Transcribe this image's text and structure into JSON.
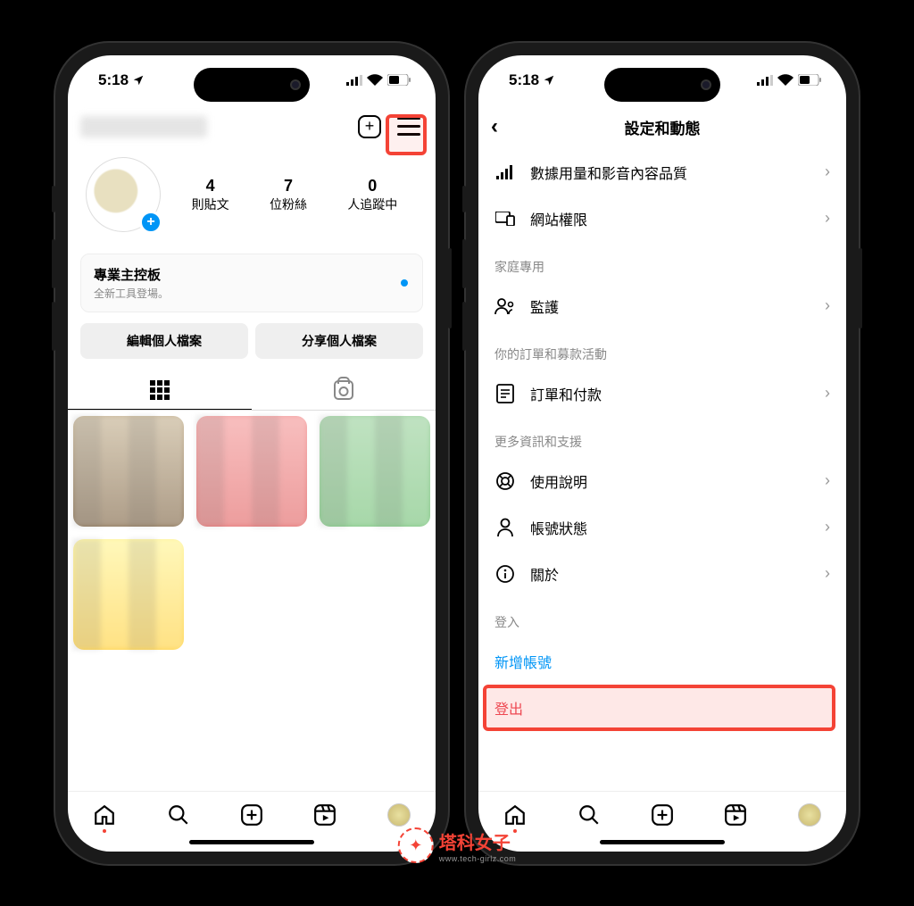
{
  "status": {
    "time": "5:18",
    "location_arrow": "➤"
  },
  "profile": {
    "stats": {
      "posts_num": "4",
      "posts_lbl": "則貼文",
      "followers_num": "7",
      "followers_lbl": "位粉絲",
      "following_num": "0",
      "following_lbl": "人追蹤中"
    },
    "dashboard": {
      "title": "專業主控板",
      "sub": "全新工具登場。"
    },
    "edit_btn": "編輯個人檔案",
    "share_btn": "分享個人檔案"
  },
  "settings": {
    "title": "設定和動態",
    "rows": {
      "data_quality": "數據用量和影音內容品質",
      "website": "網站權限"
    },
    "section_family": "家庭專用",
    "supervision": "監護",
    "section_orders": "你的訂單和募款活動",
    "orders": "訂單和付款",
    "section_more": "更多資訊和支援",
    "help": "使用說明",
    "account_status": "帳號狀態",
    "about": "關於",
    "section_login": "登入",
    "add_account": "新增帳號",
    "logout": "登出"
  },
  "watermark": {
    "main": "塔科女子",
    "sub": "www.tech-girlz.com"
  }
}
